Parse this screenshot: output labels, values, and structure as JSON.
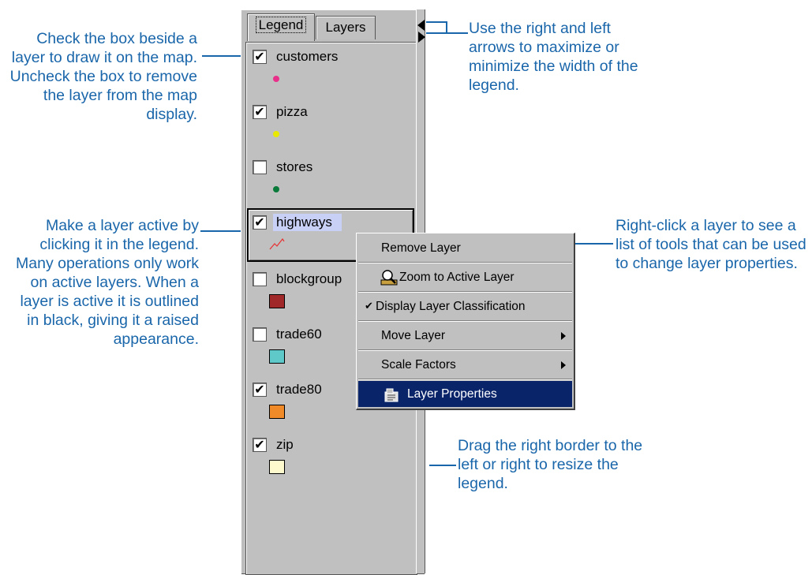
{
  "callouts": {
    "checkbox": "Check the box beside a layer to draw it on the map. Uncheck the box to remove the layer from the map display.",
    "active": "Make a layer active by clicking it in the legend. Many operations only work on active layers. When a layer is active it is outlined in black, giving it a raised appearance.",
    "arrows": "Use the right and left arrows to maximize or minimize the width of the legend.",
    "rightclick": "Right-click a layer to see a list of tools that can be used to change layer properties.",
    "drag": "Drag the right border to the left or right to resize the legend."
  },
  "tabs": [
    {
      "label": "Legend",
      "active": true
    },
    {
      "label": "Layers",
      "active": false
    }
  ],
  "layers": [
    {
      "name": "customers",
      "checked": true,
      "symbol": "point",
      "color": "#e8308a"
    },
    {
      "name": "pizza",
      "checked": true,
      "symbol": "point",
      "color": "#e8e800"
    },
    {
      "name": "stores",
      "checked": false,
      "symbol": "point",
      "color": "#0a7a3a"
    },
    {
      "name": "highways",
      "checked": true,
      "symbol": "line",
      "color": "#e83030",
      "active": true
    },
    {
      "name": "blockgroup",
      "checked": false,
      "symbol": "polygon",
      "color": "#a02828"
    },
    {
      "name": "trade60",
      "checked": false,
      "symbol": "polygon",
      "color": "#5fc8c8"
    },
    {
      "name": "trade80",
      "checked": true,
      "symbol": "polygon",
      "color": "#f08a28"
    },
    {
      "name": "zip",
      "checked": true,
      "symbol": "polygon",
      "color": "#fffacd"
    }
  ],
  "menu": {
    "items": [
      {
        "label": "Remove Layer",
        "icon": "",
        "submenu": false,
        "checked": false
      },
      {
        "label": "Zoom to Active Layer",
        "icon": "magnifier-icon",
        "submenu": false,
        "checked": false
      },
      {
        "label": "Display Layer Classification",
        "icon": "",
        "submenu": false,
        "checked": true
      },
      {
        "label": "Move Layer",
        "icon": "",
        "submenu": true,
        "checked": false
      },
      {
        "label": "Scale Factors",
        "icon": "",
        "submenu": true,
        "checked": false
      },
      {
        "label": "Layer Properties",
        "icon": "properties-icon",
        "submenu": false,
        "checked": false,
        "selected": true
      }
    ]
  },
  "colors": {
    "callout": "#1a66aa",
    "menu_highlight": "#0a246a",
    "panel": "#c0c0c0"
  }
}
